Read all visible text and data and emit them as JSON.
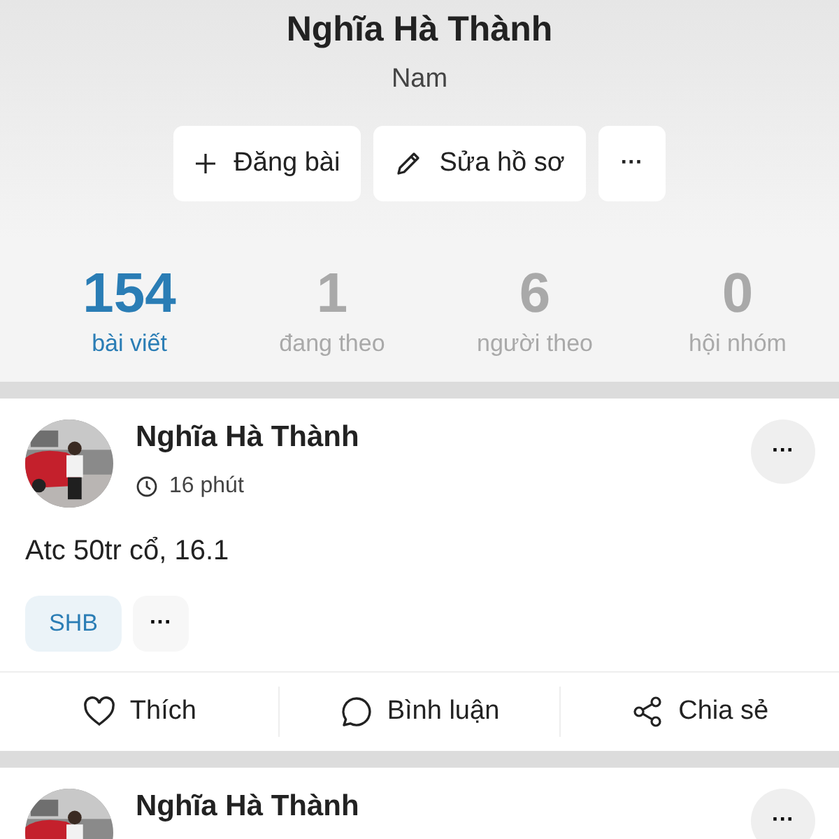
{
  "profile": {
    "name": "Nghĩa Hà Thành",
    "gender": "Nam"
  },
  "actions": [
    {
      "kind": "post",
      "label": "Đăng bài"
    },
    {
      "kind": "edit",
      "label": "Sửa hồ sơ"
    },
    {
      "kind": "more",
      "label": "···"
    }
  ],
  "stats": [
    {
      "value": "154",
      "label": "bài viết",
      "selected": true
    },
    {
      "value": "1",
      "label": "đang theo",
      "selected": false
    },
    {
      "value": "6",
      "label": "người theo",
      "selected": false
    },
    {
      "value": "0",
      "label": "hội nhóm",
      "selected": false
    }
  ],
  "posts": [
    {
      "author": "Nghĩa Hà Thành",
      "time": "16 phút",
      "more": "···",
      "text": "Atc 50tr cổ, 16.1",
      "tags": [
        "SHB"
      ],
      "tags_more": "···",
      "reactions": [
        {
          "kind": "like",
          "label": "Thích"
        },
        {
          "kind": "comment",
          "label": "Bình luận"
        },
        {
          "kind": "share",
          "label": "Chia sẻ"
        }
      ]
    },
    {
      "author": "Nghĩa Hà Thành",
      "more": "···"
    }
  ]
}
